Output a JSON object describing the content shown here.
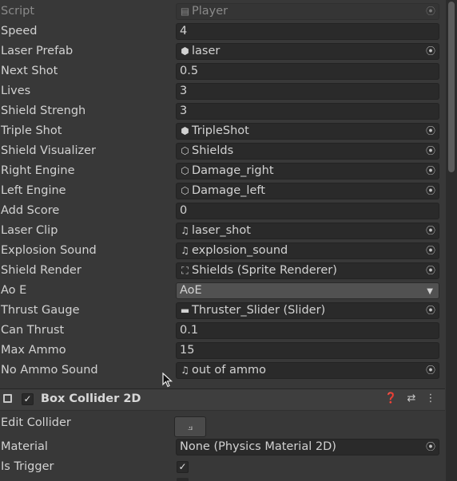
{
  "fields": [
    {
      "label": "Script",
      "value": "Player",
      "kind": "object",
      "icon": "script-icon",
      "glyph": "▤",
      "disabled": true
    },
    {
      "label": "Speed",
      "value": "4",
      "kind": "text"
    },
    {
      "label": "Laser Prefab",
      "value": "laser",
      "kind": "object",
      "icon": "prefab-icon",
      "glyph": "⬢"
    },
    {
      "label": "Next Shot",
      "value": "0.5",
      "kind": "text"
    },
    {
      "label": "Lives",
      "value": "3",
      "kind": "text"
    },
    {
      "label": "Shield Strengh",
      "value": "3",
      "kind": "text"
    },
    {
      "label": "Triple Shot",
      "value": "TripleShot",
      "kind": "object",
      "icon": "prefab-icon",
      "glyph": "⬢"
    },
    {
      "label": "Shield Visualizer",
      "value": "Shields",
      "kind": "object",
      "icon": "gameobject-icon",
      "glyph": "⬡"
    },
    {
      "label": "Right Engine",
      "value": "Damage_right",
      "kind": "object",
      "icon": "gameobject-icon",
      "glyph": "⬡"
    },
    {
      "label": "Left Engine",
      "value": "Damage_left",
      "kind": "object",
      "icon": "gameobject-icon",
      "glyph": "⬡"
    },
    {
      "label": "Add Score",
      "value": "0",
      "kind": "text"
    },
    {
      "label": "Laser Clip",
      "value": "laser_shot",
      "kind": "object",
      "icon": "audio-clip-icon",
      "glyph": "♫"
    },
    {
      "label": "Explosion Sound",
      "value": "explosion_sound",
      "kind": "object",
      "icon": "audio-clip-icon",
      "glyph": "♫"
    },
    {
      "label": "Shield Render",
      "value": "Shields (Sprite Renderer)",
      "kind": "object",
      "icon": "sprite-renderer-icon",
      "glyph": "⛶"
    },
    {
      "label": "Ao E",
      "value": "AoE",
      "kind": "dropdown"
    },
    {
      "label": "Thrust Gauge",
      "value": "Thruster_Slider (Slider)",
      "kind": "object",
      "icon": "slider-icon",
      "glyph": "▬"
    },
    {
      "label": "Can Thrust",
      "value": "0.1",
      "kind": "text"
    },
    {
      "label": "Max Ammo",
      "value": "15",
      "kind": "text"
    },
    {
      "label": "No Ammo Sound",
      "value": "out of ammo",
      "kind": "object",
      "icon": "audio-clip-icon",
      "glyph": "♫"
    }
  ],
  "component": {
    "title": "Box Collider 2D",
    "enabled": true,
    "help_icon": "help-icon",
    "presets_icon": "presets-icon",
    "menu_icon": "kebab-menu-icon"
  },
  "collider": {
    "edit_label": "Edit Collider",
    "edit_icon": "edit-collider-icon",
    "material_label": "Material",
    "material_value": "None (Physics Material 2D)",
    "trigger_label": "Is Trigger",
    "trigger_checked": true
  },
  "picker_glyph": "⦿",
  "check_glyph": "✓"
}
